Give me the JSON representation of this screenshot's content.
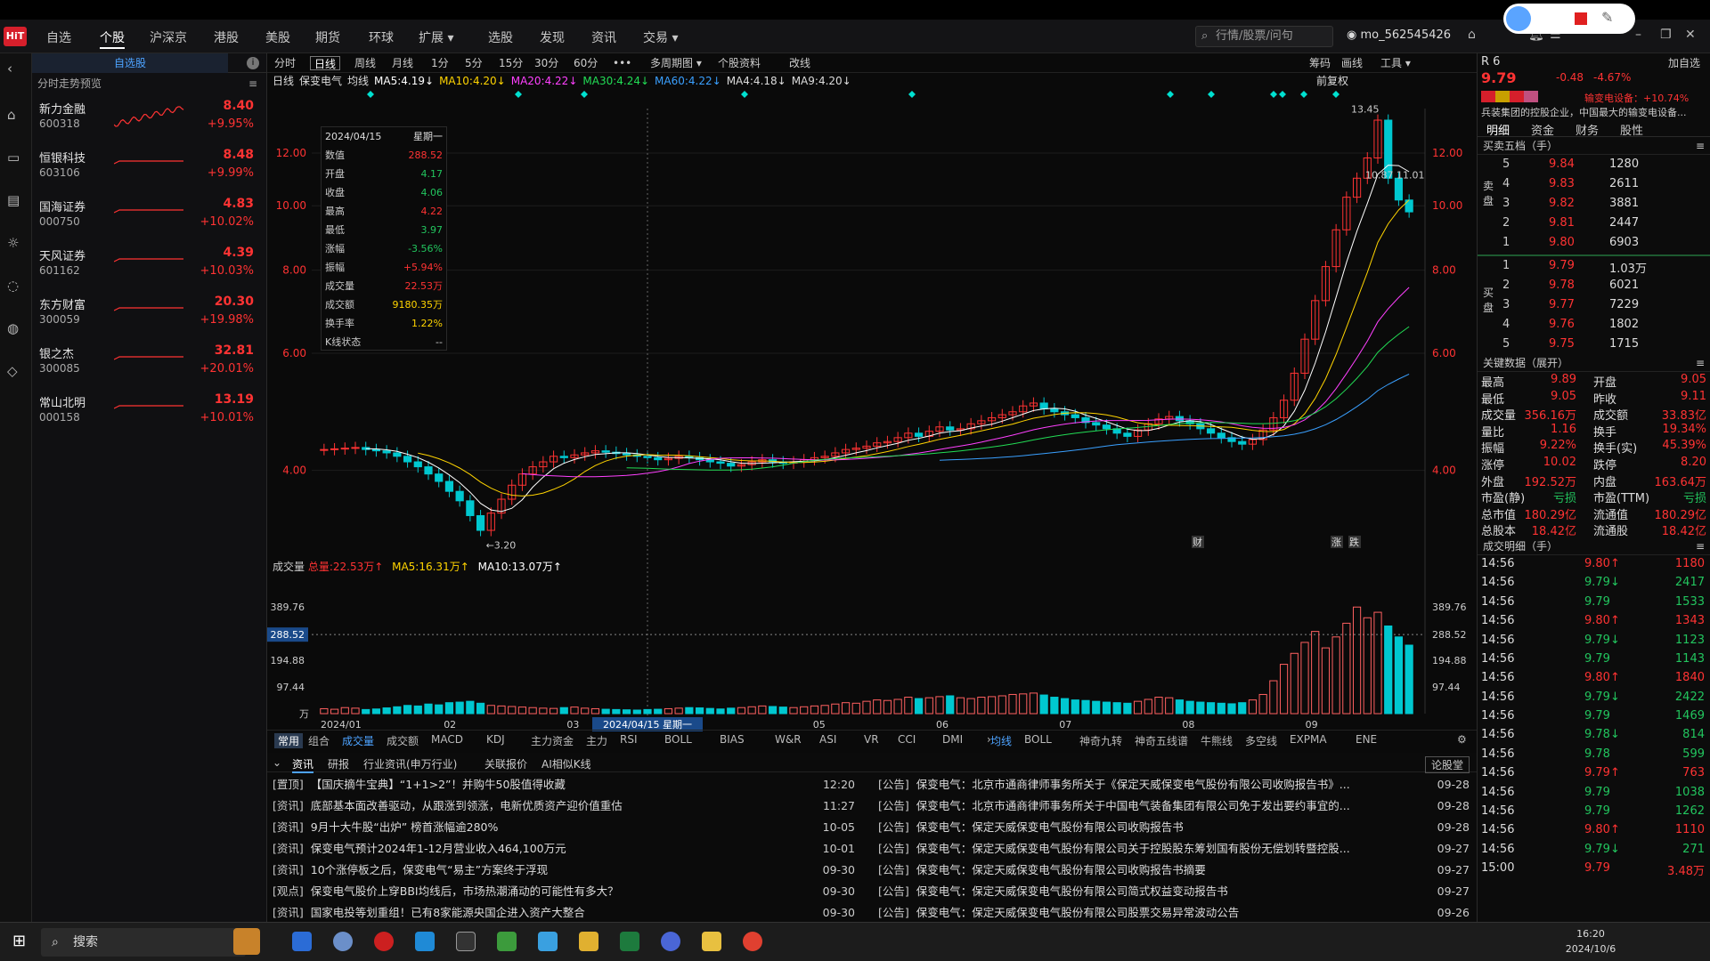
{
  "app": {
    "logo": "HiT"
  },
  "nav": [
    "自选",
    "个股",
    "沪深京",
    "港股",
    "美股",
    "期货",
    "环球",
    "扩展 ▾",
    "选股",
    "发现",
    "资讯",
    "交易 ▾"
  ],
  "nav_active": 1,
  "search_placeholder": "行情/股票/问句",
  "user": "mo_562545426",
  "watchlist": {
    "tab": "自选股",
    "sub": "分时走势预览",
    "items": [
      {
        "name": "新力金融",
        "code": "600318",
        "price": "8.40",
        "chg": "+9.95%"
      },
      {
        "name": "恒银科技",
        "code": "603106",
        "price": "8.48",
        "chg": "+9.99%"
      },
      {
        "name": "国海证券",
        "code": "000750",
        "price": "4.83",
        "chg": "+10.02%"
      },
      {
        "name": "天风证券",
        "code": "601162",
        "price": "4.39",
        "chg": "+10.03%"
      },
      {
        "name": "东方财富",
        "code": "300059",
        "price": "20.30",
        "chg": "+19.98%"
      },
      {
        "name": "银之杰",
        "code": "300085",
        "price": "32.81",
        "chg": "+20.01%"
      },
      {
        "name": "常山北明",
        "code": "000158",
        "price": "13.19",
        "chg": "+10.01%"
      }
    ]
  },
  "period_tabs": [
    "分时",
    "日线",
    "周线",
    "月线",
    "1分",
    "5分",
    "15分",
    "30分",
    "60分",
    "•••",
    "多周期图 ▾",
    "个股资料",
    "改线"
  ],
  "period_active": 1,
  "period_right": [
    "筹码",
    "画线",
    "工具 ▾"
  ],
  "ma_line": {
    "label": "日线",
    "name": "保变电气",
    "type": "均线",
    "items": [
      {
        "t": "MA5:4.19↓",
        "color": "#ffffff"
      },
      {
        "t": "MA10:4.20↓",
        "color": "#ffd400"
      },
      {
        "t": "MA20:4.22↓",
        "color": "#ff40ff"
      },
      {
        "t": "MA30:4.24↓",
        "color": "#22dd55"
      },
      {
        "t": "MA60:4.22↓",
        "color": "#3aa0ff"
      },
      {
        "t": "MA4:4.18↓",
        "color": "#dddddd"
      },
      {
        "t": "MA9:4.20↓",
        "color": "#dddddd"
      }
    ],
    "fuquan": "前复权"
  },
  "ohlc": {
    "date": "2024/04/15",
    "week": "星期一",
    "rows": [
      {
        "k": "数值",
        "v": "288.52",
        "c": "#ff3333"
      },
      {
        "k": "开盘",
        "v": "4.17",
        "c": "#22c55e"
      },
      {
        "k": "收盘",
        "v": "4.06",
        "c": "#22c55e"
      },
      {
        "k": "最高",
        "v": "4.22",
        "c": "#ff3333"
      },
      {
        "k": "最低",
        "v": "3.97",
        "c": "#22c55e"
      },
      {
        "k": "涨幅",
        "v": "-3.56%",
        "c": "#22c55e"
      },
      {
        "k": "振幅",
        "v": "+5.94%",
        "c": "#ff3333"
      },
      {
        "k": "成交量",
        "v": "22.53万",
        "c": "#ff3333"
      },
      {
        "k": "成交额",
        "v": "9180.35万",
        "c": "#ffd400"
      },
      {
        "k": "换手率",
        "v": "1.22%",
        "c": "#ffd400"
      },
      {
        "k": "K线状态",
        "v": "--",
        "c": "#cccccc"
      }
    ]
  },
  "chart_data": {
    "type": "candlestick",
    "title": "保变电气 日线",
    "x_range": [
      "2024/01",
      "2024/10/08"
    ],
    "month_ticks": [
      "2024/01",
      "02",
      "03",
      "04",
      "05",
      "06",
      "07",
      "08",
      "09"
    ],
    "y_ticks": [
      4.0,
      6.0,
      8.0,
      10.0,
      12.0
    ],
    "ylim": [
      3.0,
      14.0
    ],
    "scale": "log",
    "annotations": {
      "high": "13.45",
      "low": "3.20",
      "mid": "10.87 11.01"
    },
    "event_markers": [
      "财",
      "涨",
      "跌"
    ],
    "crosshair_date": "2024/04/15 星期一",
    "closes": [
      4.3,
      4.31,
      4.32,
      4.33,
      4.3,
      4.28,
      4.25,
      4.2,
      4.12,
      4.05,
      3.95,
      3.85,
      3.72,
      3.6,
      3.42,
      3.25,
      3.45,
      3.62,
      3.8,
      3.95,
      4.05,
      4.12,
      4.2,
      4.18,
      4.22,
      4.25,
      4.28,
      4.26,
      4.24,
      4.22,
      4.2,
      4.18,
      4.15,
      4.17,
      4.2,
      4.18,
      4.15,
      4.12,
      4.1,
      4.06,
      4.08,
      4.12,
      4.15,
      4.12,
      4.1,
      4.12,
      4.15,
      4.18,
      4.2,
      4.25,
      4.3,
      4.32,
      4.35,
      4.4,
      4.42,
      4.48,
      4.55,
      4.5,
      4.58,
      4.65,
      4.6,
      4.62,
      4.7,
      4.75,
      4.8,
      4.85,
      4.9,
      5.0,
      5.05,
      4.95,
      4.9,
      4.85,
      4.8,
      4.72,
      4.68,
      4.62,
      4.55,
      4.5,
      4.6,
      4.7,
      4.78,
      4.82,
      4.75,
      4.7,
      4.62,
      4.55,
      4.48,
      4.42,
      4.38,
      4.45,
      4.6,
      4.8,
      5.1,
      5.6,
      6.3,
      7.2,
      8.1,
      9.2,
      10.3,
      11.0,
      11.8,
      13.45,
      11.0,
      10.2,
      9.79
    ],
    "volume": {
      "ylabel": "万",
      "y_ticks": [
        97.44,
        194.88,
        288.52,
        389.76
      ],
      "total": "总量:22.53万↑",
      "ma5": "MA5:16.31万↑",
      "ma10": "MA10:13.07万↑",
      "values": [
        18,
        16,
        22,
        20,
        15,
        17,
        21,
        25,
        30,
        28,
        35,
        32,
        40,
        42,
        45,
        38,
        30,
        28,
        26,
        24,
        22,
        20,
        19,
        22,
        24,
        20,
        18,
        16,
        15,
        14,
        13,
        15,
        16,
        18,
        20,
        22,
        21,
        19,
        17,
        20,
        22,
        25,
        28,
        26,
        24,
        22,
        25,
        28,
        30,
        35,
        40,
        38,
        45,
        50,
        48,
        52,
        60,
        55,
        58,
        62,
        65,
        58,
        55,
        60,
        62,
        65,
        70,
        72,
        75,
        68,
        60,
        55,
        50,
        48,
        45,
        42,
        40,
        38,
        45,
        52,
        60,
        58,
        50,
        45,
        42,
        40,
        38,
        36,
        40,
        50,
        70,
        120,
        180,
        220,
        260,
        300,
        240,
        280,
        330,
        389,
        350,
        370,
        320,
        280,
        250
      ]
    }
  },
  "indicator_tabs": [
    "常用",
    "组合",
    "成交量",
    "成交额",
    "MACD",
    "KDJ",
    "主力资金",
    "主力",
    "RSI",
    "BOLL",
    "BIAS",
    "W&R",
    "ASI",
    "VR",
    "CCI",
    "DMI",
    "›"
  ],
  "indicator_right": [
    "均线",
    "BOLL",
    "神奇九转",
    "神奇五线谱",
    "牛熊线",
    "多空线",
    "EXPMA",
    "ENE"
  ],
  "news": {
    "tabs": [
      "资讯",
      "研报",
      "行业资讯(申万行业)",
      "关联报价",
      "AI相似K线"
    ],
    "btn": "论股堂",
    "left": [
      {
        "tag": "[置顶]",
        "t": "【国庆摘牛宝典】“1+1>2”！并购牛50股值得收藏",
        "tm": "12:20"
      },
      {
        "tag": "[资讯]",
        "t": "底部基本面改善驱动，从跟涨到领涨，电新优质资产迎价值重估",
        "tm": "11:27"
      },
      {
        "tag": "[资讯]",
        "t": "9月十大牛股“出炉” 榜首涨幅逾280%",
        "tm": "10-05"
      },
      {
        "tag": "[资讯]",
        "t": "保变电气预计2024年1-12月营业收入464,100万元",
        "tm": "10-01"
      },
      {
        "tag": "[资讯]",
        "t": "10个涨停板之后，保变电气“易主”方案终于浮现",
        "tm": "09-30"
      },
      {
        "tag": "[观点]",
        "t": "保变电气股价上穿BBI均线后，市场热潮涌动的可能性有多大？",
        "tm": "09-30"
      },
      {
        "tag": "[资讯]",
        "t": "国家电投等划重组！已有8家能源央国企进入资产大整合",
        "tm": "09-30"
      }
    ],
    "right": [
      {
        "tag": "[公告]",
        "t": "保变电气：北京市通商律师事务所关于《保定天威保变电气股份有限公司收购报告书》...",
        "tm": "09-28"
      },
      {
        "tag": "[公告]",
        "t": "保变电气：北京市通商律师事务所关于中国电气装备集团有限公司免于发出要约事宜的...",
        "tm": "09-28"
      },
      {
        "tag": "[公告]",
        "t": "保变电气：保定天威保变电气股份有限公司收购报告书",
        "tm": "09-28"
      },
      {
        "tag": "[公告]",
        "t": "保变电气：保定天威保变电气股份有限公司关于控股股东筹划国有股份无偿划转暨控股...",
        "tm": "09-27"
      },
      {
        "tag": "[公告]",
        "t": "保变电气：保定天威保变电气股份有限公司收购报告书摘要",
        "tm": "09-27"
      },
      {
        "tag": "[公告]",
        "t": "保变电气：保定天威保变电气股份有限公司简式权益变动报告书",
        "tm": "09-27"
      },
      {
        "tag": "[公告]",
        "t": "保变电气：保定天威保变电气股份有限公司股票交易异常波动公告",
        "tm": "09-26"
      }
    ]
  },
  "right_panel": {
    "price": "9.79",
    "change": "-0.48",
    "pct": "-4.67%",
    "industry": "输变电设备：+10.74%",
    "desc": "兵装集团的控股企业，中国最大的输变电设备...",
    "tabs": [
      "明细",
      "资金",
      "财务",
      "股性"
    ],
    "order_head": "买卖五档（手）",
    "asks": [
      {
        "n": "5",
        "p": "9.84",
        "v": "1280"
      },
      {
        "n": "4",
        "p": "9.83",
        "v": "2611"
      },
      {
        "n": "3",
        "p": "9.82",
        "v": "3881"
      },
      {
        "n": "2",
        "p": "9.81",
        "v": "2447"
      },
      {
        "n": "1",
        "p": "9.80",
        "v": "6903"
      }
    ],
    "bids": [
      {
        "n": "1",
        "p": "9.79",
        "v": "1.03万"
      },
      {
        "n": "2",
        "p": "9.78",
        "v": "6021"
      },
      {
        "n": "3",
        "p": "9.77",
        "v": "7229"
      },
      {
        "n": "4",
        "p": "9.76",
        "v": "1802"
      },
      {
        "n": "5",
        "p": "9.75",
        "v": "1715"
      }
    ],
    "ask_label": "卖盘",
    "bid_label": "买盘",
    "key_head": "关键数据（展开）",
    "key": [
      [
        "最高",
        "9.89",
        "开盘",
        "9.05"
      ],
      [
        "最低",
        "9.05",
        "昨收",
        "9.11"
      ],
      [
        "成交量",
        "356.16万",
        "成交额",
        "33.83亿"
      ],
      [
        "量比",
        "1.16",
        "换手",
        "19.34%"
      ],
      [
        "振幅",
        "9.22%",
        "换手(实)",
        "45.39%"
      ],
      [
        "涨停",
        "10.02",
        "跌停",
        "8.20"
      ],
      [
        "外盘",
        "192.52万",
        "内盘",
        "163.64万"
      ],
      [
        "市盈(静)",
        "亏损",
        "市盈(TTM)",
        "亏损"
      ],
      [
        "总市值",
        "180.29亿",
        "流通值",
        "180.29亿"
      ],
      [
        "总股本",
        "18.42亿",
        "流通股",
        "18.42亿"
      ]
    ],
    "trade_head": "成交明细（手）",
    "trades": [
      {
        "t": "14:56",
        "p": "9.80↑",
        "v": "1180",
        "c": "#ff3333"
      },
      {
        "t": "14:56",
        "p": "9.79↓",
        "v": "2417",
        "c": "#22c55e"
      },
      {
        "t": "14:56",
        "p": "9.79",
        "v": "1533",
        "c": "#22c55e"
      },
      {
        "t": "14:56",
        "p": "9.80↑",
        "v": "1343",
        "c": "#ff3333"
      },
      {
        "t": "14:56",
        "p": "9.79↓",
        "v": "1123",
        "c": "#22c55e"
      },
      {
        "t": "14:56",
        "p": "9.79",
        "v": "1143",
        "c": "#22c55e"
      },
      {
        "t": "14:56",
        "p": "9.80↑",
        "v": "1840",
        "c": "#ff3333"
      },
      {
        "t": "14:56",
        "p": "9.79↓",
        "v": "2422",
        "c": "#22c55e"
      },
      {
        "t": "14:56",
        "p": "9.79",
        "v": "1469",
        "c": "#22c55e"
      },
      {
        "t": "14:56",
        "p": "9.78↓",
        "v": "814",
        "c": "#22c55e"
      },
      {
        "t": "14:56",
        "p": "9.78",
        "v": "599",
        "c": "#22c55e"
      },
      {
        "t": "14:56",
        "p": "9.79↑",
        "v": "763",
        "c": "#ff3333"
      },
      {
        "t": "14:56",
        "p": "9.79",
        "v": "1038",
        "c": "#22c55e"
      },
      {
        "t": "14:56",
        "p": "9.79",
        "v": "1262",
        "c": "#22c55e"
      },
      {
        "t": "14:56",
        "p": "9.80↑",
        "v": "1110",
        "c": "#ff3333"
      },
      {
        "t": "14:56",
        "p": "9.79↓",
        "v": "271",
        "c": "#22c55e"
      },
      {
        "t": "15:00",
        "p": "9.79",
        "v": "3.48万",
        "c": "#ff3333"
      }
    ]
  },
  "taskbar": {
    "search": "搜索",
    "time": "16:20",
    "date": "2024/10/6"
  }
}
